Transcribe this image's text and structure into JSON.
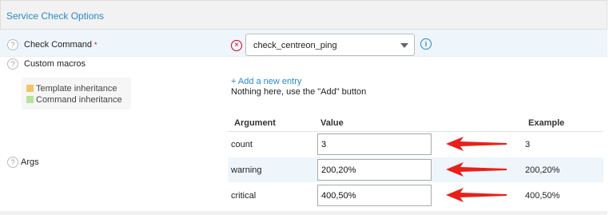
{
  "section": {
    "title": "Service Check Options"
  },
  "check_command": {
    "label": "Check Command",
    "required_mark": "*",
    "selected": "check_centreon_ping"
  },
  "custom_macros": {
    "label": "Custom macros",
    "legend": {
      "template": {
        "label": "Template inheritance",
        "color": "#f4c36a"
      },
      "command": {
        "label": "Command inheritance",
        "color": "#b7e39a"
      }
    },
    "add_link": "+ Add a new entry",
    "empty_text": "Nothing here, use the \"Add\" button"
  },
  "args": {
    "label": "Args",
    "headers": {
      "argument": "Argument",
      "value": "Value",
      "example": "Example"
    },
    "rows": [
      {
        "name": "count",
        "value": "3",
        "example": "3"
      },
      {
        "name": "warning",
        "value": "200,20%",
        "example": "200,20%"
      },
      {
        "name": "critical",
        "value": "400,50%",
        "example": "400,50%"
      }
    ]
  },
  "colors": {
    "accent": "#2a89c7",
    "required": "#d0021b",
    "annotation_arrow": "#e8201b"
  },
  "icons": {
    "help": "help-icon",
    "clear": "clear-x-icon",
    "info": "info-icon",
    "dropdown": "chevron-down-icon"
  }
}
